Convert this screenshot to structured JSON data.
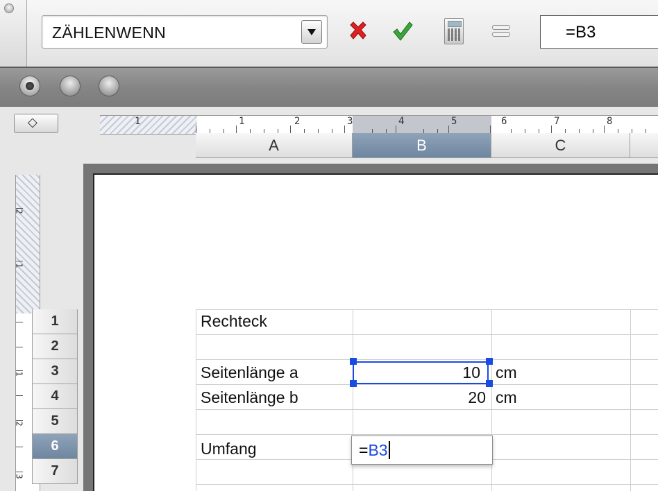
{
  "toolbar": {
    "function_name": "ZÄHLENWENN",
    "formula": "=B3"
  },
  "columns": [
    "A",
    "B",
    "C"
  ],
  "selected_column": "B",
  "rows": [
    "1",
    "2",
    "3",
    "4",
    "5",
    "6",
    "7"
  ],
  "selected_row": "6",
  "ruler": {
    "h_numbers_hatched": [
      "1"
    ],
    "h_numbers": [
      "1",
      "2",
      "3",
      "4",
      "5",
      "6",
      "7",
      "8"
    ],
    "v_numbers_hatched": [
      "2",
      "1"
    ],
    "v_numbers": [
      "1",
      "2",
      "3"
    ]
  },
  "sheet": {
    "r1": {
      "a": "Rechteck"
    },
    "r3": {
      "a": "Seitenlänge a",
      "b": "10",
      "c": "cm"
    },
    "r4": {
      "a": "Seitenlänge b",
      "b": "20",
      "c": "cm"
    },
    "r6": {
      "a": "Umfang"
    },
    "edit": {
      "prefix": "=",
      "ref": "B3"
    }
  },
  "colors": {
    "selection": "#1a4be0",
    "header_selected": "#7f95ad",
    "cancel": "#e02020",
    "accept": "#3aa63a"
  },
  "icons": [
    "cancel-icon",
    "accept-icon",
    "calculator-icon",
    "equals-icon"
  ]
}
